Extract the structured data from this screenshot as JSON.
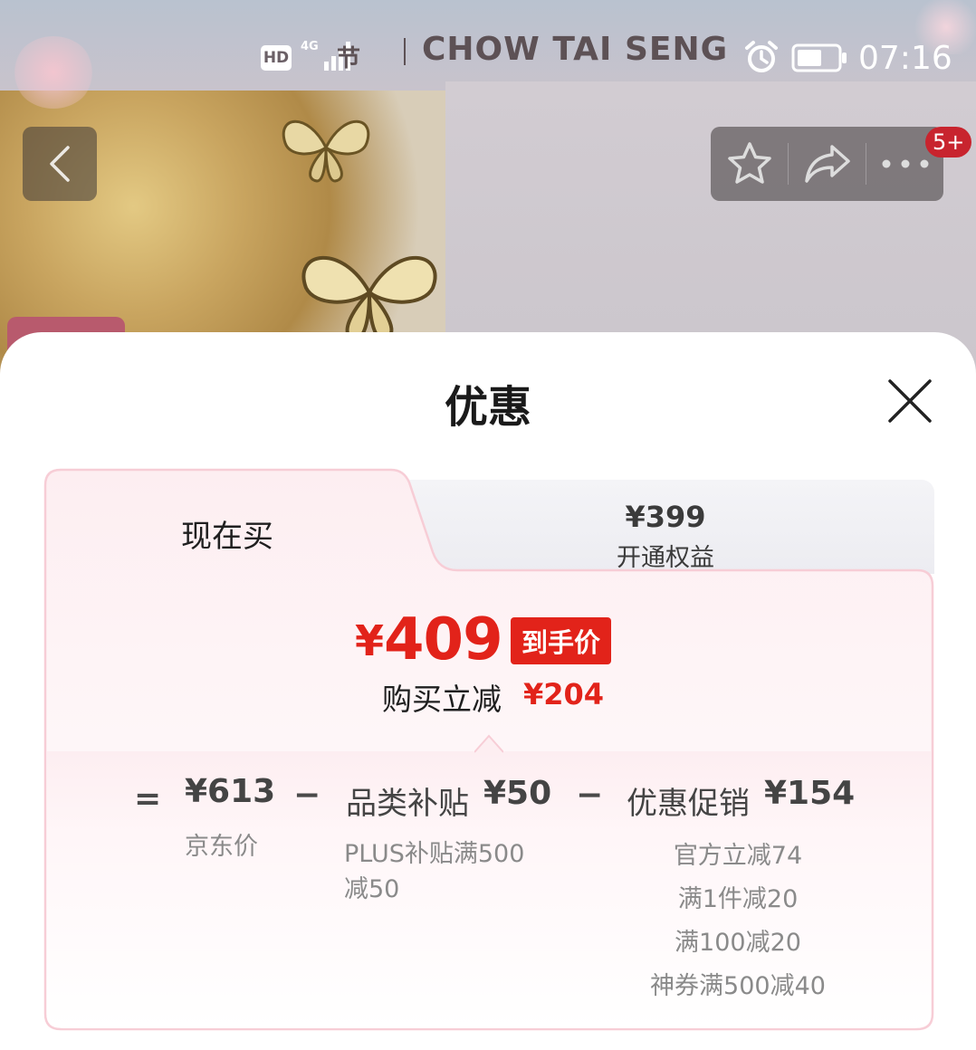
{
  "status_bar": {
    "brand": "CHOW TAI SENG",
    "brand_cn_fragment": "节",
    "hd": "HD",
    "network": "4G",
    "time": "07:16"
  },
  "nav": {
    "back_icon": "chevron-left-icon",
    "favorite_icon": "star-icon",
    "share_icon": "share-icon",
    "more_icon": "more-icon",
    "notification_badge": "5+"
  },
  "sheet": {
    "title": "优惠",
    "close_icon": "close-icon",
    "tabs": [
      {
        "label": "现在买",
        "selected": true
      },
      {
        "price": "¥399",
        "label": "开通权益",
        "selected": false
      }
    ],
    "final": {
      "currency": "¥",
      "price": "409",
      "tag": "到手价",
      "saving_label": "购买立减",
      "saving_amount": "¥204"
    },
    "breakdown": {
      "equals": "=",
      "minus": "−",
      "base": {
        "value": "¥613",
        "label": "京东价"
      },
      "subsidy": {
        "name": "品类补贴",
        "value": "¥50",
        "detail_line1": "PLUS补贴满500",
        "detail_line2": "减50"
      },
      "promotion": {
        "name": "优惠促销",
        "value": "¥154",
        "items": [
          "官方立减74",
          "满1件减20",
          "满100减20",
          "神券满500减40"
        ]
      }
    }
  },
  "colors": {
    "accent_red": "#e2231a",
    "card_border": "#f7cdd6",
    "text_dark": "#1f1f1f",
    "text_muted": "#8a8a8a"
  }
}
